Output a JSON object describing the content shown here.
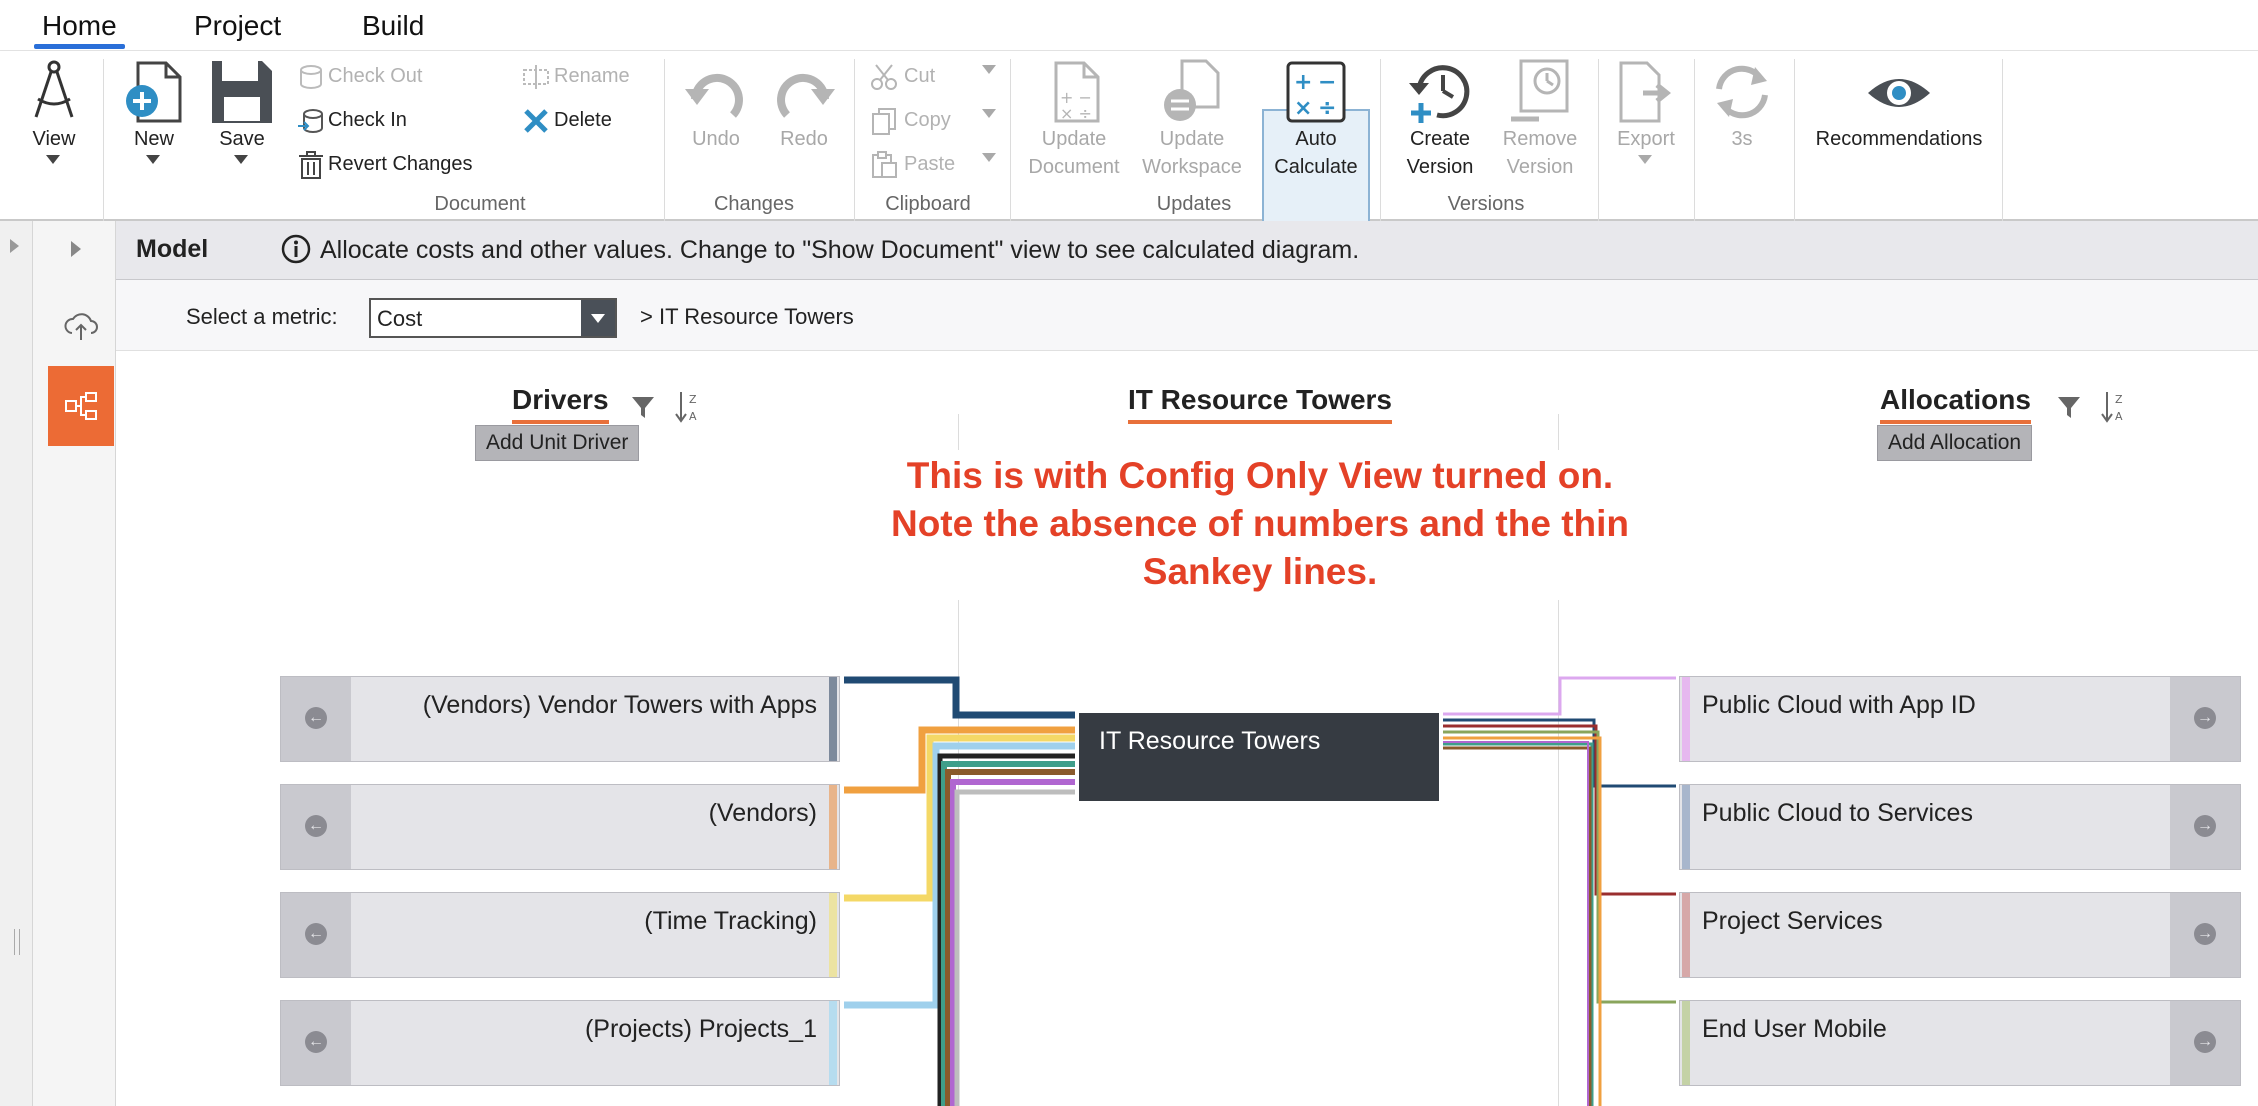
{
  "menu": {
    "tabs": [
      "Home",
      "Project",
      "Build"
    ]
  },
  "ribbon": {
    "view": "View",
    "new": "New",
    "save": "Save",
    "check_out": "Check Out",
    "check_in": "Check In",
    "revert": "Revert Changes",
    "rename": "Rename",
    "delete": "Delete",
    "undo": "Undo",
    "redo": "Redo",
    "cut": "Cut",
    "copy": "Copy",
    "paste": "Paste",
    "update_document": [
      "Update",
      "Document"
    ],
    "update_workspace": [
      "Update",
      "Workspace"
    ],
    "auto_calculate": [
      "Auto",
      "Calculate"
    ],
    "create_version": [
      "Create",
      "Version"
    ],
    "remove_version": [
      "Remove",
      "Version"
    ],
    "export": "Export",
    "refresh": "3s",
    "recommendations": "Recommendations",
    "groups": {
      "document": "Document",
      "changes": "Changes",
      "clipboard": "Clipboard",
      "updates": "Updates",
      "versions": "Versions"
    }
  },
  "model": {
    "title": "Model",
    "info": "Allocate costs and other values. Change to \"Show Document\" view to see calculated diagram."
  },
  "metric": {
    "label": "Select a metric:",
    "value": "Cost",
    "breadcrumb": "> IT Resource Towers"
  },
  "columns": {
    "drivers": "Drivers",
    "center": "IT Resource Towers",
    "allocations": "Allocations",
    "add_driver": "Add Unit Driver",
    "add_allocation": "Add Allocation"
  },
  "note": [
    "This is with Config Only View turned on.",
    "Note the absence of numbers and the thin",
    "Sankey lines."
  ],
  "drivers": [
    {
      "label": "(Vendors) Vendor Towers with Apps",
      "color": "#7d8a9c"
    },
    {
      "label": "(Vendors)",
      "color": "#e8b48a"
    },
    {
      "label": "(Time Tracking)",
      "color": "#ece3a2"
    },
    {
      "label": "(Projects) Projects_1",
      "color": "#b6dcef"
    }
  ],
  "center_node": "IT Resource Towers",
  "allocations": [
    {
      "label": "Public Cloud with App ID",
      "color": "#e6b8ef"
    },
    {
      "label": "Public Cloud to Services",
      "color": "#a8b6cc"
    },
    {
      "label": "Project Services",
      "color": "#d6a8a8"
    },
    {
      "label": "End User Mobile",
      "color": "#c4d2a6"
    }
  ],
  "flow_colors": {
    "navy": "#204a73",
    "orange": "#f0a040",
    "yellow": "#f4d866",
    "light_blue": "#9fd0ec",
    "teal": "#3f9e8a",
    "purple": "#b066d0",
    "brown": "#8a5a2b",
    "gray": "#bdbdbd",
    "dark": "#222222",
    "pink": "#dca8ef",
    "dark_red": "#9a2e2e",
    "olive": "#8aa55c"
  }
}
